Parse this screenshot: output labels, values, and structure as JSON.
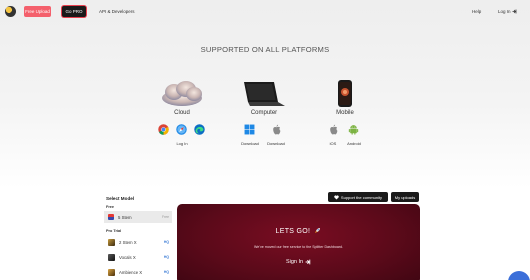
{
  "nav": {
    "free_upload": "Free Upload",
    "go_pro": "Go PRO",
    "api": "API & Developers",
    "help": "Help",
    "login": "Log In"
  },
  "hero": {
    "title": "SUPPORTED ON ALL PLATFORMS",
    "platforms": [
      {
        "label": "Cloud",
        "icons": [
          "chrome-icon",
          "safari-icon",
          "edge-icon"
        ],
        "captions": [
          "Log In"
        ]
      },
      {
        "label": "Computer",
        "icons": [
          "windows-icon",
          "apple-icon"
        ],
        "captions": [
          "Download",
          "Download"
        ]
      },
      {
        "label": "Mobile",
        "icons": [
          "apple-icon",
          "android-icon"
        ],
        "captions": [
          "iOS",
          "Android"
        ]
      }
    ]
  },
  "models": {
    "heading": "Select Model",
    "free_label": "Free",
    "free_models": [
      {
        "name": "5 Stem",
        "tag": "Free"
      }
    ],
    "pro_label": "Pro Trial",
    "pro_models": [
      {
        "name": "2 Stem X",
        "tag": "HQ"
      },
      {
        "name": "Vocals X",
        "tag": "HQ"
      },
      {
        "name": "Ambience X",
        "tag": "HQ"
      }
    ]
  },
  "actions": {
    "community": "Support the community",
    "uploads": "My uploads"
  },
  "panel": {
    "heading": "LETS GO!",
    "subtext": "We've moved our free service to the Splitter Dashboard.",
    "signin": "Sign In"
  },
  "colors": {
    "accent": "#f4606c",
    "panel": "#6a0b1e",
    "chat": "#3b6fd9"
  }
}
